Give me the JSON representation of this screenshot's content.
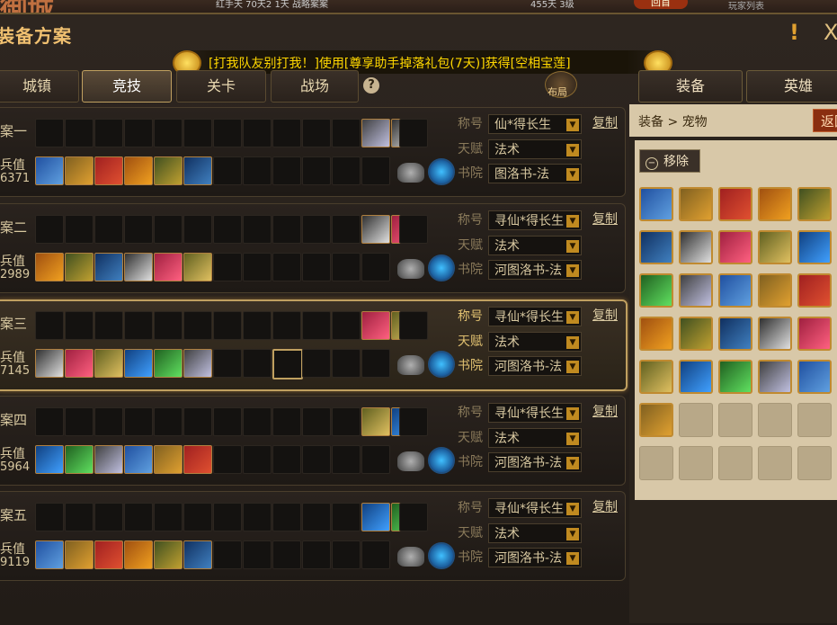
{
  "top_strip": {
    "bg_title": "御城",
    "info": "红手天 70天2 1天 战略案案",
    "info2": "455天  3级",
    "back": "回首",
    "extra": "玩家列表"
  },
  "window": {
    "title": "装备方案",
    "announcement": "[打我队友别打我！]使用[尊享助手掉落礼包(7天)]获得[空相宝莲]",
    "help": "?",
    "layout_label": "布局",
    "close": "X",
    "exclaim": "!"
  },
  "tabs": [
    "城镇",
    "竞技",
    "关卡",
    "战场"
  ],
  "active_tab": 1,
  "right_tabs": [
    "装备",
    "英雄"
  ],
  "rows": [
    {
      "name": "案一",
      "label": "兵值",
      "value": "6371",
      "title": "仙*得长生",
      "talent": "法术",
      "academy": "图洛书-法",
      "copy": "复制"
    },
    {
      "name": "案二",
      "label": "兵值",
      "value": "2989",
      "title": "寻仙*得长生",
      "talent": "法术",
      "academy": "河图洛书-法",
      "copy": "复制"
    },
    {
      "name": "案三",
      "label": "兵值",
      "value": "7145",
      "title": "寻仙*得长生",
      "talent": "法术",
      "academy": "河图洛书-法",
      "copy": "复制"
    },
    {
      "name": "案四",
      "label": "兵值",
      "value": "5964",
      "title": "寻仙*得长生",
      "talent": "法术",
      "academy": "河图洛书-法",
      "copy": "复制"
    },
    {
      "name": "案五",
      "label": "兵值",
      "value": "9119",
      "title": "寻仙*得长生",
      "talent": "法术",
      "academy": "河图洛书-法",
      "copy": "复制"
    }
  ],
  "field_labels": {
    "title": "称号",
    "talent": "天赋",
    "academy": "书院"
  },
  "selected_row": 2,
  "panel": {
    "breadcrumb": "装备 > 宠物",
    "back": "返回",
    "remove": "移除",
    "remove_icon": "−",
    "pet_count": 26,
    "empty_count": 9
  },
  "colors": {
    "accent": "#c0a060",
    "announce": "#ffd700",
    "back": "#8a2e10"
  }
}
